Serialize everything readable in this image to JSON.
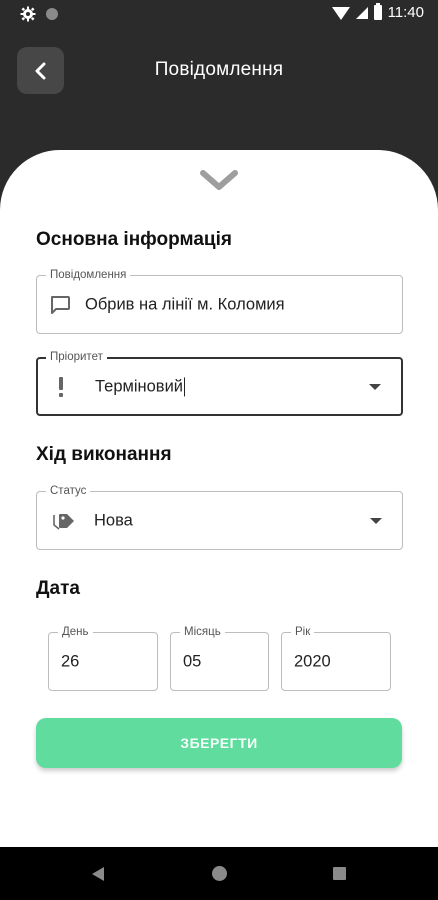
{
  "status_bar": {
    "time": "11:40",
    "icons": [
      "gear-icon",
      "circle-icon",
      "wifi-icon",
      "signal-icon",
      "battery-icon"
    ]
  },
  "app_bar": {
    "title": "Повідомлення",
    "back_icon": "chevron-left-icon"
  },
  "sheet": {
    "collapse_icon": "chevron-down-icon",
    "basic_info": {
      "title": "Основна інформація",
      "message": {
        "label": "Повідомлення",
        "value": "Обрив на лінії м. Коломия",
        "icon": "message-icon"
      },
      "priority": {
        "label": "Пріоритет",
        "value": "Терміновий",
        "icon": "exclamation-icon"
      }
    },
    "progress": {
      "title": "Хід виконання",
      "status": {
        "label": "Статус",
        "value": "Нова",
        "icon": "tag-icon"
      }
    },
    "date": {
      "title": "Дата",
      "day": {
        "label": "День",
        "value": "26"
      },
      "month": {
        "label": "Місяць",
        "value": "05"
      },
      "year": {
        "label": "Рік",
        "value": "2020"
      }
    },
    "save_label": "ЗБЕРЕГТИ"
  },
  "colors": {
    "header_bg": "#2b2b2b",
    "accent": "#5fdc9e",
    "back_button_bg": "#474747"
  },
  "nav_bar": {
    "icons": [
      "back-triangle-icon",
      "home-circle-icon",
      "recents-square-icon"
    ]
  }
}
